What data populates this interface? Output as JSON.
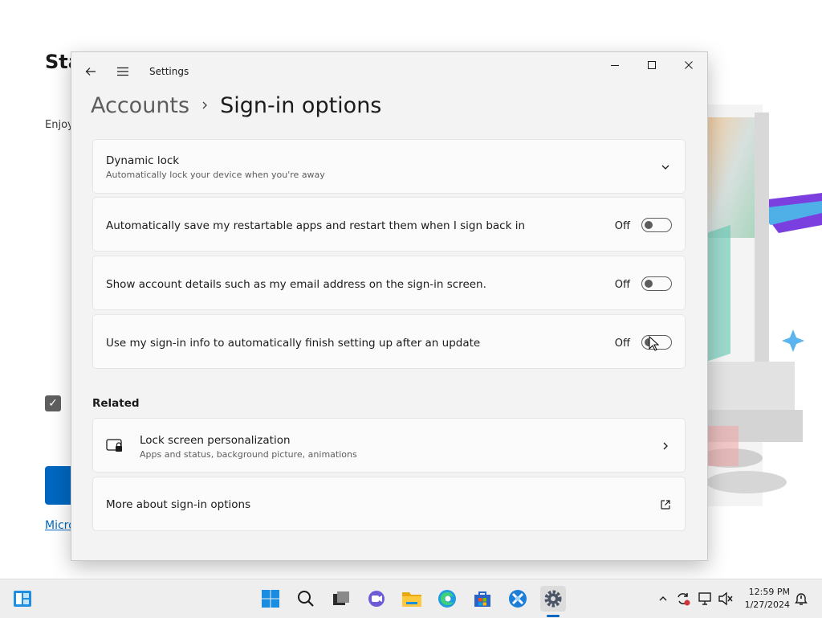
{
  "background_app": {
    "title": "Sta dat",
    "body": "Enjoy alway more",
    "link": "Micro"
  },
  "window": {
    "title": "Settings",
    "breadcrumb": {
      "parent": "Accounts",
      "current": "Sign-in options"
    },
    "controls": {
      "minimize": "minimize-icon",
      "maximize": "maximize-icon",
      "close": "close-icon"
    }
  },
  "settings": {
    "dynamic_lock": {
      "title": "Dynamic lock",
      "subtitle": "Automatically lock your device when you're away"
    },
    "toggles": [
      {
        "label": "Automatically save my restartable apps and restart them when I sign back in",
        "state": "Off"
      },
      {
        "label": "Show account details such as my email address on the sign-in screen.",
        "state": "Off"
      },
      {
        "label": "Use my sign-in info to automatically finish setting up after an update",
        "state": "Off"
      }
    ],
    "related": {
      "heading": "Related",
      "lock_screen": {
        "title": "Lock screen personalization",
        "subtitle": "Apps and status, background picture, animations"
      },
      "more": {
        "title": "More about sign-in options"
      }
    }
  },
  "taskbar": {
    "apps": [
      "widgets-icon",
      "start-icon",
      "search-icon",
      "task-view-icon",
      "chat-icon",
      "file-explorer-icon",
      "edge-icon",
      "store-icon",
      "app-icon",
      "settings-icon"
    ],
    "clock": {
      "time": "12:59 PM",
      "date": "1/27/2024"
    }
  },
  "colors": {
    "accent": "#0067c0",
    "window_bg": "#f3f3f3",
    "card_bg": "#fbfbfb",
    "text_primary": "#1b1b1b",
    "text_secondary": "#5d5d5d"
  }
}
